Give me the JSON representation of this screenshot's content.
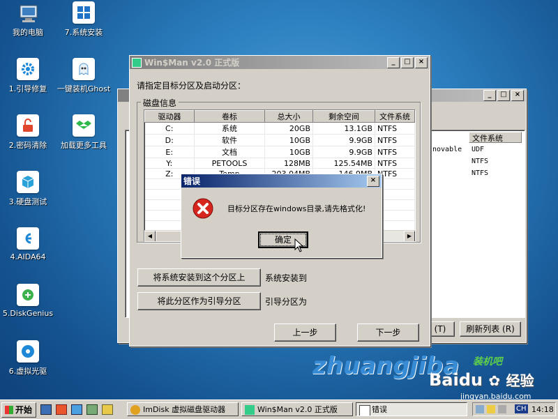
{
  "desktop_icons": [
    {
      "label": "我的电脑"
    },
    {
      "label": "7.系统安装"
    },
    {
      "label": "1.引导修复"
    },
    {
      "label": "一键装机Ghost"
    },
    {
      "label": "2.密码清除"
    },
    {
      "label": "加载更多工具"
    },
    {
      "label": "3.硬盘测试"
    },
    {
      "label": "4.AIDA64"
    },
    {
      "label": "5.DiskGenius"
    },
    {
      "label": "6.虚拟光驱"
    }
  ],
  "back_window": {
    "columns": [
      "文件系统"
    ],
    "rows": [
      {
        "prefix": "novable",
        "fs": "UDF"
      },
      {
        "prefix": "",
        "fs": "NTFS"
      },
      {
        "prefix": "",
        "fs": "NTFS"
      }
    ],
    "refresh_button": "刷新列表 (R)",
    "left_button": "(T)"
  },
  "winsman": {
    "title": "Win$Man v2.0 正式版",
    "prompt": "请指定目标分区及启动分区：",
    "group_label": "磁盘信息",
    "columns": [
      "驱动器",
      "卷标",
      "总大小",
      "剩余空间",
      "文件系统"
    ],
    "rows": [
      {
        "drive": "C:",
        "label": "系统",
        "total": "20GB",
        "free": "13.1GB",
        "fs": "NTFS"
      },
      {
        "drive": "D:",
        "label": "软件",
        "total": "10GB",
        "free": "9.9GB",
        "fs": "NTFS"
      },
      {
        "drive": "E:",
        "label": "文档",
        "total": "10GB",
        "free": "9.9GB",
        "fs": "NTFS"
      },
      {
        "drive": "Y:",
        "label": "PETOOLS",
        "total": "128MB",
        "free": "125.54MB",
        "fs": "NTFS"
      },
      {
        "drive": "Z:",
        "label": "Temp",
        "total": "203.04MB",
        "free": "146.9MB",
        "fs": "NTFS"
      }
    ],
    "install_button": "将系统安装到这个分区上",
    "install_label": "系统安装到",
    "boot_button": "将此分区作为引导分区",
    "boot_label": "引导分区为",
    "prev_button": "上一步",
    "next_button": "下一步"
  },
  "error_dialog": {
    "title": "错误",
    "message": "目标分区存在windows目录,请先格式化!",
    "ok_button": "确定"
  },
  "watermark": {
    "brand": "zhuangjiba",
    "brand_cn": "装机吧",
    "baidu": "Baidu",
    "baidu_cn": "经验",
    "url": "jingyan.baidu.com"
  },
  "taskbar": {
    "start_label": "开始",
    "tasks": [
      {
        "label": "ImDisk 虚拟磁盘驱动器"
      },
      {
        "label": "Win$Man v2.0 正式版"
      },
      {
        "label": "错误"
      }
    ],
    "ime": "CH",
    "clock": "14:18"
  }
}
